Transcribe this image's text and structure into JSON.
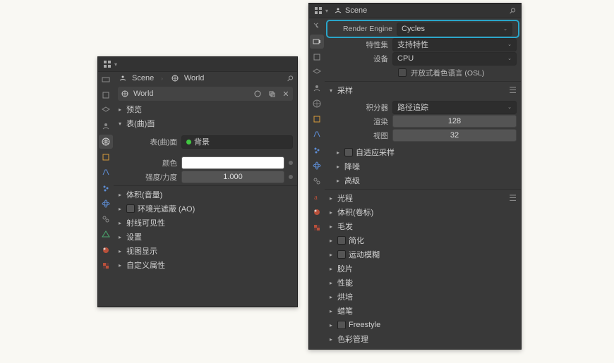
{
  "left": {
    "crumb1": "Scene",
    "crumb2": "World",
    "datablock": "World",
    "sections": {
      "preview": "预览",
      "surface": "表(曲)面",
      "volume": "体积(音量)",
      "ao": "环境光遮蔽 (AO)",
      "rayvis": "射线可见性",
      "settings": "设置",
      "viewport": "视图显示",
      "custom": "自定义属性"
    },
    "rows": {
      "surface_label": "表(曲)面",
      "surface_value": "背景",
      "color_label": "颜色",
      "strength_label": "强度/力度",
      "strength_value": "1.000"
    }
  },
  "right": {
    "crumb": "Scene",
    "engine_label": "Render Engine",
    "engine_value": "Cycles",
    "featureset_label": "特性集",
    "featureset_value": "支持特性",
    "device_label": "设备",
    "device_value": "CPU",
    "osl_label": "开放式着色语言 (OSL)",
    "sampling": "采样",
    "integrator_label": "积分器",
    "integrator_value": "路径追踪",
    "render_label": "渲染",
    "render_value": "128",
    "viewport_label": "视图",
    "viewport_value": "32",
    "adaptive": "自适应采样",
    "denoise": "降噪",
    "advanced": "高级",
    "lightpaths": "光程",
    "volumes": "体积(卷标)",
    "hair": "毛发",
    "simplify": "简化",
    "motionblur": "运动模糊",
    "film": "胶片",
    "performance": "性能",
    "bake": "烘培",
    "grease": "蜡笔",
    "freestyle": "Freestyle",
    "colormgmt": "色彩管理"
  }
}
